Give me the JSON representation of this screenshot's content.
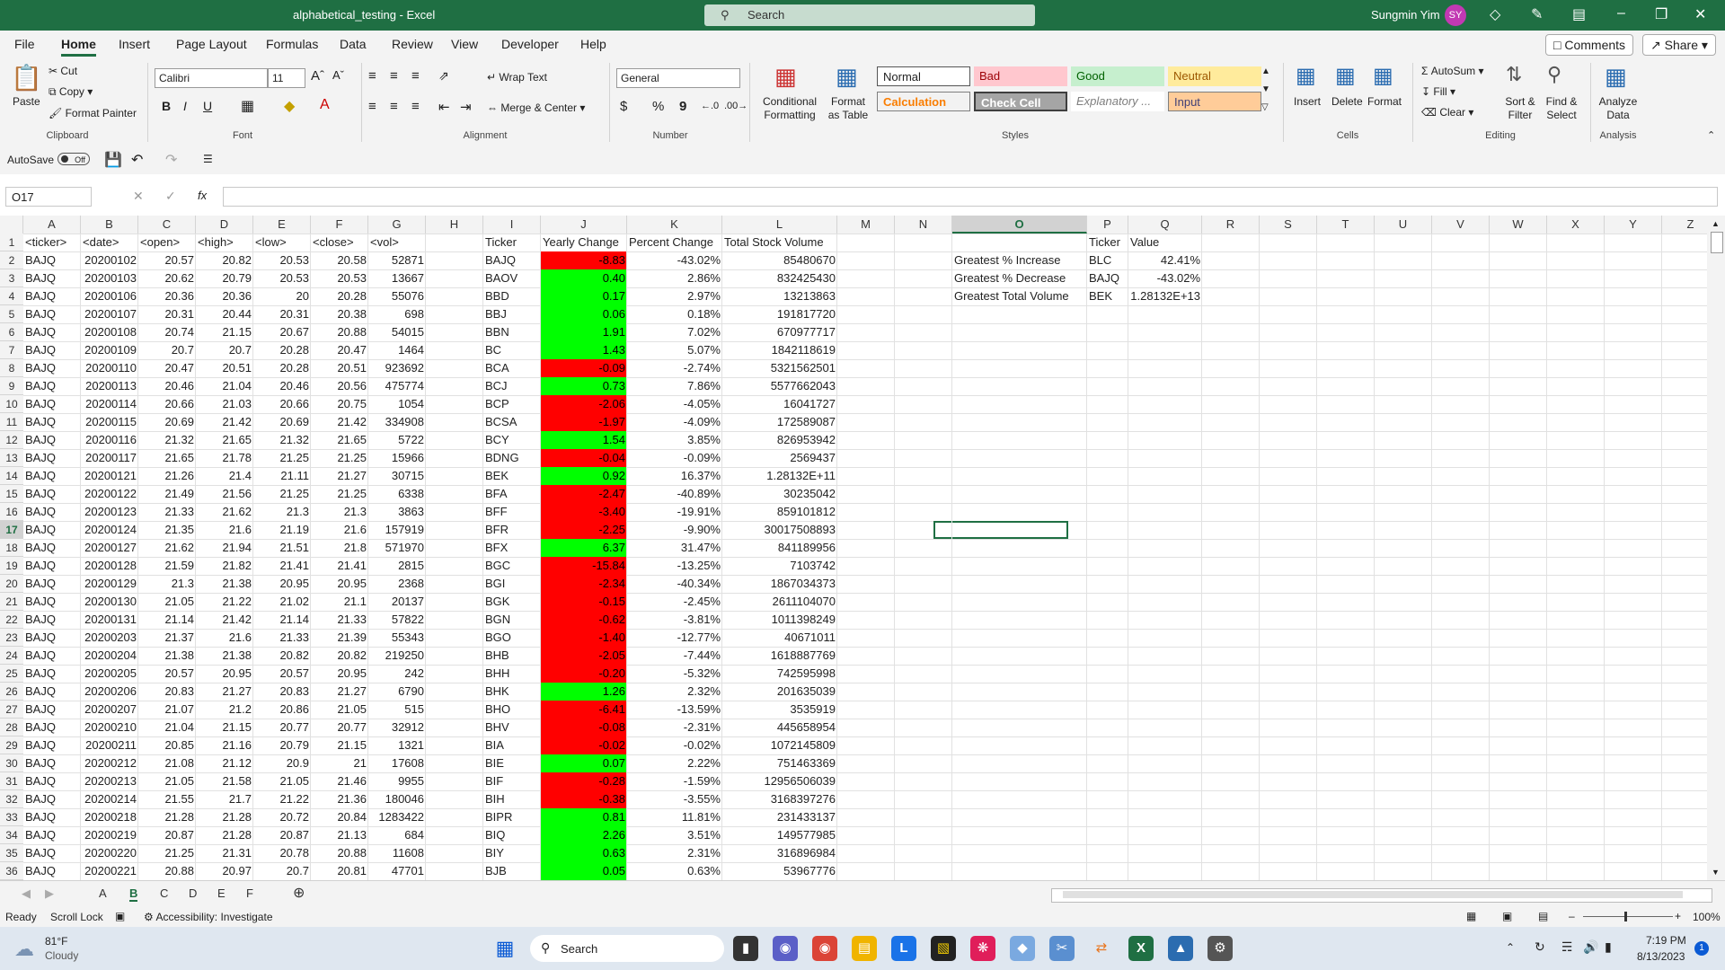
{
  "window": {
    "title": "alphabetical_testing  -  Excel",
    "search_placeholder": "Search",
    "user_name": "Sungmin Yim",
    "user_initials": "SY"
  },
  "menu": {
    "tabs": [
      "File",
      "Home",
      "Insert",
      "Page Layout",
      "Formulas",
      "Data",
      "Review",
      "View",
      "Developer",
      "Help"
    ],
    "active": "Home",
    "comments": "Comments",
    "share": "Share"
  },
  "ribbon": {
    "clipboard": {
      "label": "Clipboard",
      "paste": "Paste",
      "cut": "Cut",
      "copy": "Copy",
      "format_painter": "Format Painter"
    },
    "font": {
      "label": "Font",
      "name": "Calibri",
      "size": "11",
      "bold": "B",
      "italic": "I",
      "underline": "U"
    },
    "alignment": {
      "label": "Alignment",
      "wrap": "Wrap Text",
      "merge": "Merge & Center"
    },
    "number": {
      "label": "Number",
      "format": "General",
      "currency": "$",
      "percent": "%",
      "comma": "9"
    },
    "styles": {
      "label": "Styles",
      "cond_fmt": "Conditional Formatting",
      "format_table": "Format as Table",
      "normal": "Normal",
      "bad": "Bad",
      "good": "Good",
      "neutral": "Neutral",
      "calculation": "Calculation",
      "check_cell": "Check Cell",
      "explanatory": "Explanatory ...",
      "input": "Input"
    },
    "cells": {
      "label": "Cells",
      "insert": "Insert",
      "delete": "Delete",
      "format": "Format"
    },
    "editing": {
      "label": "Editing",
      "autosum": "AutoSum",
      "fill": "Fill",
      "clear": "Clear",
      "sort": "Sort & Filter",
      "find": "Find & Select"
    },
    "analysis": {
      "label": "Analysis",
      "analyze": "Analyze Data"
    }
  },
  "qat": {
    "autosave": "AutoSave",
    "toggle": "Off"
  },
  "formula_bar": {
    "name_box": "O17",
    "fx": "fx",
    "value": ""
  },
  "columns": [
    "A",
    "B",
    "C",
    "D",
    "E",
    "F",
    "G",
    "H",
    "I",
    "J",
    "K",
    "L",
    "M",
    "N",
    "O",
    "P",
    "Q",
    "R",
    "S",
    "T",
    "U",
    "V",
    "W",
    "X",
    "Y",
    "Z"
  ],
  "selected_col": "O",
  "selected_row": 17,
  "headers": {
    "a": "<ticker>",
    "b": "<date>",
    "c": "<open>",
    "d": "<high>",
    "e": "<low>",
    "f": "<close>",
    "g": "<vol>",
    "i": "Ticker",
    "j": "Yearly Change",
    "k": "Percent Change",
    "l": "Total Stock Volume",
    "p": "Ticker",
    "q": "Value"
  },
  "raw_rows": [
    [
      "BAJQ",
      "20200102",
      "20.57",
      "20.82",
      "20.53",
      "20.58",
      "52871"
    ],
    [
      "BAJQ",
      "20200103",
      "20.62",
      "20.79",
      "20.53",
      "20.53",
      "13667"
    ],
    [
      "BAJQ",
      "20200106",
      "20.36",
      "20.36",
      "20",
      "20.28",
      "55076"
    ],
    [
      "BAJQ",
      "20200107",
      "20.31",
      "20.44",
      "20.31",
      "20.38",
      "698"
    ],
    [
      "BAJQ",
      "20200108",
      "20.74",
      "21.15",
      "20.67",
      "20.88",
      "54015"
    ],
    [
      "BAJQ",
      "20200109",
      "20.7",
      "20.7",
      "20.28",
      "20.47",
      "1464"
    ],
    [
      "BAJQ",
      "20200110",
      "20.47",
      "20.51",
      "20.28",
      "20.51",
      "923692"
    ],
    [
      "BAJQ",
      "20200113",
      "20.46",
      "21.04",
      "20.46",
      "20.56",
      "475774"
    ],
    [
      "BAJQ",
      "20200114",
      "20.66",
      "21.03",
      "20.66",
      "20.75",
      "1054"
    ],
    [
      "BAJQ",
      "20200115",
      "20.69",
      "21.42",
      "20.69",
      "21.42",
      "334908"
    ],
    [
      "BAJQ",
      "20200116",
      "21.32",
      "21.65",
      "21.32",
      "21.65",
      "5722"
    ],
    [
      "BAJQ",
      "20200117",
      "21.65",
      "21.78",
      "21.25",
      "21.25",
      "15966"
    ],
    [
      "BAJQ",
      "20200121",
      "21.26",
      "21.4",
      "21.11",
      "21.27",
      "30715"
    ],
    [
      "BAJQ",
      "20200122",
      "21.49",
      "21.56",
      "21.25",
      "21.25",
      "6338"
    ],
    [
      "BAJQ",
      "20200123",
      "21.33",
      "21.62",
      "21.3",
      "21.3",
      "3863"
    ],
    [
      "BAJQ",
      "20200124",
      "21.35",
      "21.6",
      "21.19",
      "21.6",
      "157919"
    ],
    [
      "BAJQ",
      "20200127",
      "21.62",
      "21.94",
      "21.51",
      "21.8",
      "571970"
    ],
    [
      "BAJQ",
      "20200128",
      "21.59",
      "21.82",
      "21.41",
      "21.41",
      "2815"
    ],
    [
      "BAJQ",
      "20200129",
      "21.3",
      "21.38",
      "20.95",
      "20.95",
      "2368"
    ],
    [
      "BAJQ",
      "20200130",
      "21.05",
      "21.22",
      "21.02",
      "21.1",
      "20137"
    ],
    [
      "BAJQ",
      "20200131",
      "21.14",
      "21.42",
      "21.14",
      "21.33",
      "57822"
    ],
    [
      "BAJQ",
      "20200203",
      "21.37",
      "21.6",
      "21.33",
      "21.39",
      "55343"
    ],
    [
      "BAJQ",
      "20200204",
      "21.38",
      "21.38",
      "20.82",
      "20.82",
      "219250"
    ],
    [
      "BAJQ",
      "20200205",
      "20.57",
      "20.95",
      "20.57",
      "20.95",
      "242"
    ],
    [
      "BAJQ",
      "20200206",
      "20.83",
      "21.27",
      "20.83",
      "21.27",
      "6790"
    ],
    [
      "BAJQ",
      "20200207",
      "21.07",
      "21.2",
      "20.86",
      "21.05",
      "515"
    ],
    [
      "BAJQ",
      "20200210",
      "21.04",
      "21.15",
      "20.77",
      "20.77",
      "32912"
    ],
    [
      "BAJQ",
      "20200211",
      "20.85",
      "21.16",
      "20.79",
      "21.15",
      "1321"
    ],
    [
      "BAJQ",
      "20200212",
      "21.08",
      "21.12",
      "20.9",
      "21",
      "17608"
    ],
    [
      "BAJQ",
      "20200213",
      "21.05",
      "21.58",
      "21.05",
      "21.46",
      "9955"
    ],
    [
      "BAJQ",
      "20200214",
      "21.55",
      "21.7",
      "21.22",
      "21.36",
      "180046"
    ],
    [
      "BAJQ",
      "20200218",
      "21.28",
      "21.28",
      "20.72",
      "20.84",
      "1283422"
    ],
    [
      "BAJQ",
      "20200219",
      "20.87",
      "21.28",
      "20.87",
      "21.13",
      "684"
    ],
    [
      "BAJQ",
      "20200220",
      "21.25",
      "21.31",
      "20.78",
      "20.88",
      "11608"
    ],
    [
      "BAJQ",
      "20200221",
      "20.88",
      "20.97",
      "20.7",
      "20.81",
      "47701"
    ]
  ],
  "summary_rows": [
    [
      "BAJQ",
      "-8.83",
      "-43.02%",
      "85480670"
    ],
    [
      "BAOV",
      "0.40",
      "2.86%",
      "832425430"
    ],
    [
      "BBD",
      "0.17",
      "2.97%",
      "13213863"
    ],
    [
      "BBJ",
      "0.06",
      "0.18%",
      "191817720"
    ],
    [
      "BBN",
      "1.91",
      "7.02%",
      "670977717"
    ],
    [
      "BC",
      "1.43",
      "5.07%",
      "1842118619"
    ],
    [
      "BCA",
      "-0.09",
      "-2.74%",
      "5321562501"
    ],
    [
      "BCJ",
      "0.73",
      "7.86%",
      "5577662043"
    ],
    [
      "BCP",
      "-2.06",
      "-4.05%",
      "16041727"
    ],
    [
      "BCSA",
      "-1.97",
      "-4.09%",
      "172589087"
    ],
    [
      "BCY",
      "1.54",
      "3.85%",
      "826953942"
    ],
    [
      "BDNG",
      "-0.04",
      "-0.09%",
      "2569437"
    ],
    [
      "BEK",
      "0.92",
      "16.37%",
      "1.28132E+11"
    ],
    [
      "BFA",
      "-2.47",
      "-40.89%",
      "30235042"
    ],
    [
      "BFF",
      "-3.40",
      "-19.91%",
      "859101812"
    ],
    [
      "BFR",
      "-2.25",
      "-9.90%",
      "30017508893"
    ],
    [
      "BFX",
      "6.37",
      "31.47%",
      "841189956"
    ],
    [
      "BGC",
      "-15.84",
      "-13.25%",
      "7103742"
    ],
    [
      "BGI",
      "-2.34",
      "-40.34%",
      "1867034373"
    ],
    [
      "BGK",
      "-0.15",
      "-2.45%",
      "2611104070"
    ],
    [
      "BGN",
      "-0.62",
      "-3.81%",
      "1011398249"
    ],
    [
      "BGO",
      "-1.40",
      "-12.77%",
      "40671011"
    ],
    [
      "BHB",
      "-2.05",
      "-7.44%",
      "1618887769"
    ],
    [
      "BHH",
      "-0.20",
      "-5.32%",
      "742595998"
    ],
    [
      "BHK",
      "1.26",
      "2.32%",
      "201635039"
    ],
    [
      "BHO",
      "-6.41",
      "-13.59%",
      "3535919"
    ],
    [
      "BHV",
      "-0.08",
      "-2.31%",
      "445658954"
    ],
    [
      "BIA",
      "-0.02",
      "-0.02%",
      "1072145809"
    ],
    [
      "BIE",
      "0.07",
      "2.22%",
      "751463369"
    ],
    [
      "BIF",
      "-0.28",
      "-1.59%",
      "12956506039"
    ],
    [
      "BIH",
      "-0.38",
      "-3.55%",
      "3168397276"
    ],
    [
      "BIPR",
      "0.81",
      "11.81%",
      "231433137"
    ],
    [
      "BIQ",
      "2.26",
      "3.51%",
      "149577985"
    ],
    [
      "BIY",
      "0.63",
      "2.31%",
      "316896984"
    ],
    [
      "BJB",
      "0.05",
      "0.63%",
      "53967776"
    ]
  ],
  "greatest": [
    [
      "Greatest % Increase",
      "BLC",
      "42.41%"
    ],
    [
      "Greatest % Decrease",
      "BAJQ",
      "-43.02%"
    ],
    [
      "Greatest Total Volume",
      "BEK",
      "1.28132E+13"
    ]
  ],
  "sheet_tabs": [
    "A",
    "B",
    "C",
    "D",
    "E",
    "F"
  ],
  "active_sheet": "B",
  "status": {
    "ready": "Ready",
    "scroll_lock": "Scroll Lock",
    "accessibility": "Accessibility: Investigate",
    "zoom": "100%"
  },
  "taskbar": {
    "temp": "81°F",
    "weather": "Cloudy",
    "search": "Search",
    "time": "7:19 PM",
    "date": "8/13/2023",
    "badge": "1"
  },
  "colors": {
    "excel_green": "#1f6f43",
    "neg": "#ff0000",
    "pos": "#00ff00"
  }
}
